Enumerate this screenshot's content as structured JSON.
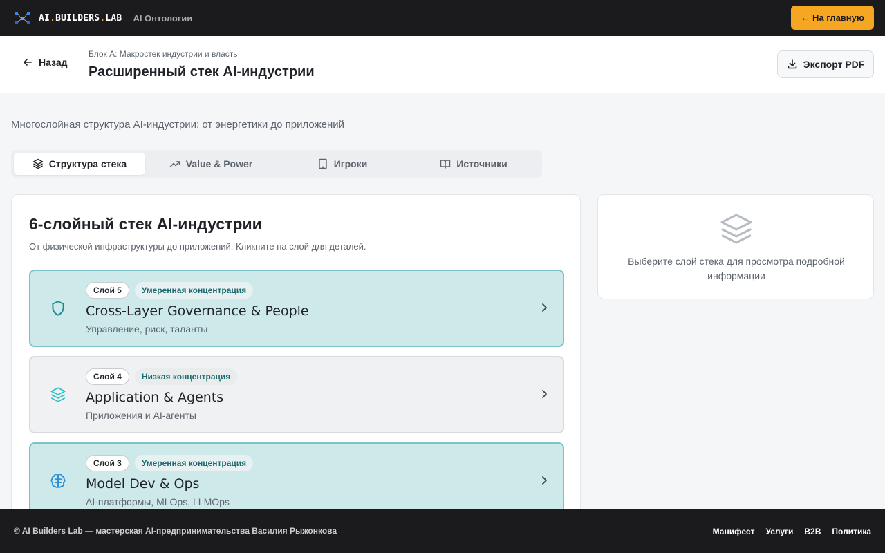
{
  "topbar": {
    "logo_prefix": "AI",
    "logo_mid": "BUILDERS",
    "logo_suffix": "LAB",
    "section": "AI Онтологии",
    "home_button": "← На главную"
  },
  "header": {
    "back": "Назад",
    "breadcrumb": "Блок А: Макростек индустрии и власть",
    "title": "Расширенный стек AI-индустрии",
    "export": "Экспорт PDF"
  },
  "subtitle": "Многослойная структура AI-индустрии: от энергетики до приложений",
  "tabs": [
    {
      "label": "Структура стека",
      "icon": "layers-icon",
      "active": true
    },
    {
      "label": "Value & Power",
      "icon": "trending-up-icon",
      "active": false
    },
    {
      "label": "Игроки",
      "icon": "building-icon",
      "active": false
    },
    {
      "label": "Источники",
      "icon": "book-icon",
      "active": false
    }
  ],
  "main": {
    "title": "6-слойный стек AI-индустрии",
    "description": "От физической инфраструктуры до приложений. Кликните на слой для деталей.",
    "layers": [
      {
        "number": "Слой 5",
        "concentration": "Умеренная концентрация",
        "name": "Cross-Layer Governance & People",
        "subtitle": "Управление, риск, таланты",
        "icon": "shield-icon",
        "variant": "teal"
      },
      {
        "number": "Слой 4",
        "concentration": "Низкая концентрация",
        "name": "Application & Agents",
        "subtitle": "Приложения и AI-агенты",
        "icon": "layers-icon",
        "variant": "gray"
      },
      {
        "number": "Слой 3",
        "concentration": "Умеренная концентрация",
        "name": "Model Dev & Ops",
        "subtitle": "AI-платформы, MLOps, LLMOps",
        "icon": "brain-icon",
        "variant": "teal"
      }
    ]
  },
  "side": {
    "text": "Выберите слой стека для просмотра подробной информации",
    "icon": "layers-icon"
  },
  "footer": {
    "copyright": "© AI Builders Lab — мастерская AI-предпринимательства Василия Рыжонкова",
    "links": [
      "Манифест",
      "Услуги",
      "B2B",
      "Политика"
    ]
  },
  "colors": {
    "accent": "#f5a623",
    "teal_bg": "#cde9ea",
    "teal_border": "#7cc2c8",
    "dark": "#1b1b1d"
  }
}
